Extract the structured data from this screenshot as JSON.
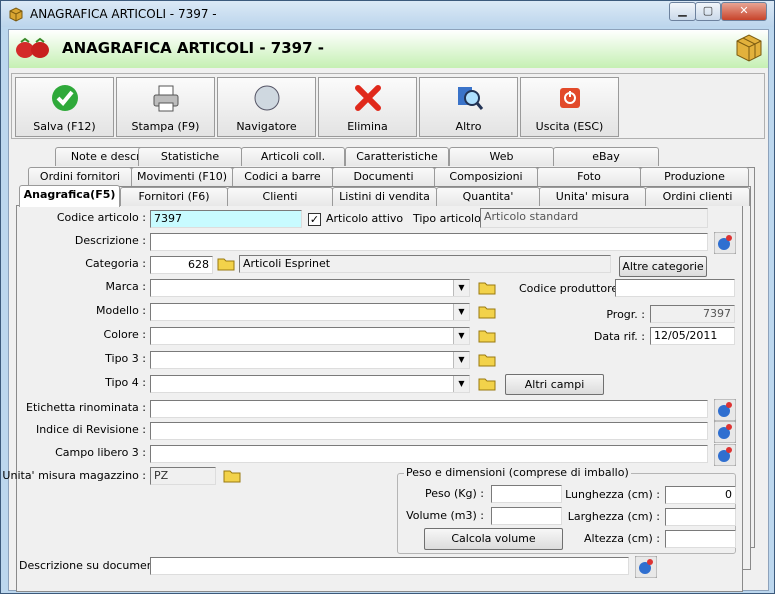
{
  "window": {
    "title": "ANAGRAFICA ARTICOLI - 7397 -",
    "min": "▁",
    "max": "▢",
    "close": "✕"
  },
  "header": {
    "title": "ANAGRAFICA ARTICOLI - 7397 -"
  },
  "toolbar": [
    {
      "label": "Salva (F12)",
      "icon": "check-icon"
    },
    {
      "label": "Stampa (F9)",
      "icon": "printer-icon"
    },
    {
      "label": "Navigatore",
      "icon": "compass-icon"
    },
    {
      "label": "Elimina",
      "icon": "delete-x-icon"
    },
    {
      "label": "Altro",
      "icon": "magnifier-icon"
    },
    {
      "label": "Uscita (ESC)",
      "icon": "power-icon"
    }
  ],
  "tabs_row1": [
    "Note e descr.",
    "Statistiche",
    "Articoli coll.",
    "Caratteristiche",
    "Web",
    "eBay"
  ],
  "tabs_row2": [
    "Ordini fornitori",
    "Movimenti (F10)",
    "Codici a barre",
    "Documenti",
    "Composizioni",
    "Foto",
    "Produzione"
  ],
  "tabs_row3": [
    "Anagrafica(F5)",
    "Fornitori (F6)",
    "Clienti",
    "Listini di vendita",
    "Quantita'",
    "Unita' misura",
    "Ordini clienti"
  ],
  "form": {
    "codice_label": "Codice articolo :",
    "codice_value": "7397",
    "attivo_label": "Articolo attivo",
    "attivo_checked": "✓",
    "tipo_label": "Tipo articolo :",
    "tipo_value": "Articolo standard",
    "descrizione_label": "Descrizione :",
    "descrizione_value": "",
    "categoria_label": "Categoria :",
    "categoria_code": "628",
    "categoria_name": "Articoli Esprinet",
    "altre_categorie": "Altre categorie",
    "marca_label": "Marca :",
    "modello_label": "Modello :",
    "colore_label": "Colore :",
    "tipo3_label": "Tipo 3 :",
    "tipo4_label": "Tipo 4 :",
    "altri_campi": "Altri campi",
    "codice_produttore_label": "Codice produttore :",
    "codice_produttore_value": "",
    "progr_label": "Progr. :",
    "progr_value": "7397",
    "datarif_label": "Data rif. :",
    "datarif_value": "12/05/2011",
    "etichetta_label": "Etichetta rinominata :",
    "indice_label": "Indice di Revisione :",
    "campo3_label": "Campo libero 3 :",
    "um_label": "Unita' misura magazzino :",
    "um_value": "PZ",
    "desc_doc_label": "Descrizione su documenti:"
  },
  "peso": {
    "title": "Peso e dimensioni (comprese di imballo)",
    "peso_label": "Peso (Kg) :",
    "volume_label": "Volume (m3) :",
    "calcola": "Calcola volume",
    "lunghezza_label": "Lunghezza (cm) :",
    "lunghezza_value": "0",
    "larghezza_label": "Larghezza (cm) :",
    "altezza_label": "Altezza (cm) :"
  }
}
